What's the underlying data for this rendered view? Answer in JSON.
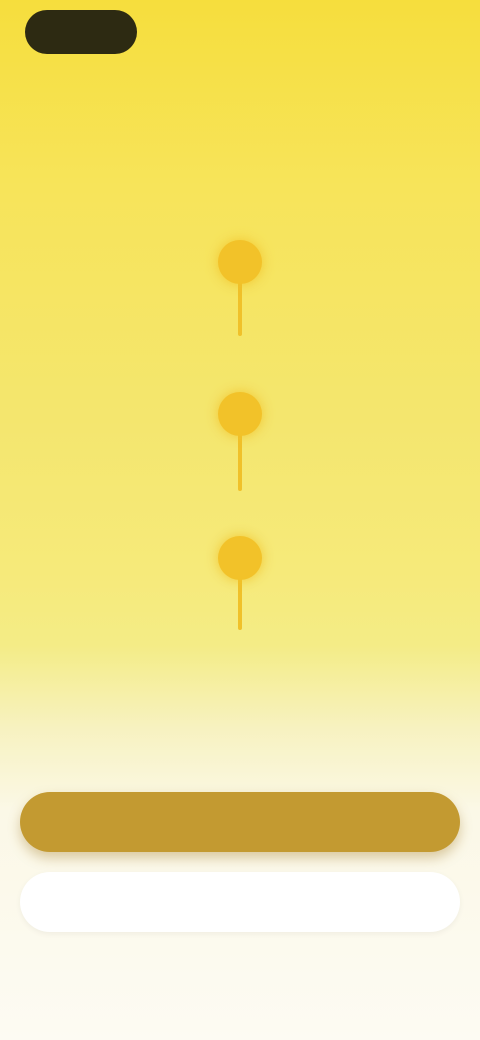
{
  "top_bar": {
    "pill_label": "",
    "right_label": ""
  },
  "header": {
    "title": ""
  },
  "steps": [
    {
      "label": ""
    },
    {
      "label": ""
    },
    {
      "label": ""
    }
  ],
  "pager": {
    "items": [
      "",
      "",
      ""
    ],
    "active_index": 2
  },
  "actions": {
    "primary_label": "",
    "secondary_label": "",
    "footer_link_label": ""
  },
  "colors": {
    "accent_yellow": "#f2c229",
    "primary_button": "#c39a31",
    "background_top": "#f6de3d",
    "background_bottom": "#fdfbf3"
  }
}
